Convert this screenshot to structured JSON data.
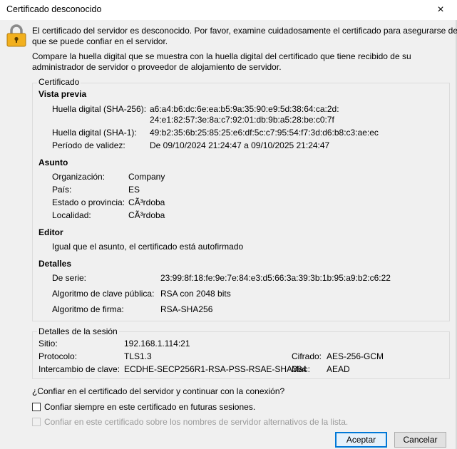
{
  "window": {
    "title": "Certificado desconocido",
    "close_icon": "×"
  },
  "intro": {
    "line1": "El certificado del servidor es desconocido. Por favor, examine cuidadosamente el certificado para asegurarse de",
    "line2": "que se puede confiar en el servidor.",
    "line3": "Compare la huella digital que se muestra con la huella digital del certificado que tiene recibido de su",
    "line4": "administrador de servidor o proveedor de alojamiento de servidor."
  },
  "certificate": {
    "group_label": "Certificado",
    "preview_heading": "Vista previa",
    "sha256_label": "Huella digital (SHA-256):",
    "sha256_line1": "a6:a4:b6:dc:6e:ea:b5:9a:35:90:e9:5d:38:64:ca:2d:",
    "sha256_line2": "24:e1:82:57:3e:8a:c7:92:01:db:9b:a5:28:be:c0:7f",
    "sha1_label": "Huella digital (SHA-1):",
    "sha1_value": "49:b2:35:6b:25:85:25:e6:df:5c:c7:95:54:f7:3d:d6:b8:c3:ae:ec",
    "validity_label": "Período de validez:",
    "validity_value": "De 09/10/2024 21:24:47 a 09/10/2025 21:24:47",
    "subject_heading": "Asunto",
    "org_label": "Organización:",
    "org_value": "Company",
    "country_label": "País:",
    "country_value": "ES",
    "state_label": "Estado o provincia:",
    "state_value": "CÃ³rdoba",
    "locality_label": "Localidad:",
    "locality_value": "CÃ³rdoba",
    "issuer_heading": "Editor",
    "issuer_value": "Igual que el asunto, el certificado está autofirmado",
    "details_heading": "Detalles",
    "serial_label": "De serie:",
    "serial_value": "23:99:8f:18:fe:9e:7e:84:e3:d5:66:3a:39:3b:1b:95:a9:b2:c6:22",
    "pubkey_label": "Algoritmo de clave pública:",
    "pubkey_value": "RSA con 2048 bits",
    "sigalg_label": "Algoritmo de firma:",
    "sigalg_value": "RSA-SHA256"
  },
  "session": {
    "group_label": "Detalles de la sesión",
    "site_label": "Sitio:",
    "site_value": "192.168.1.114:21",
    "protocol_label": "Protocolo:",
    "protocol_value": "TLS1.3",
    "cipher_label": "Cifrado:",
    "cipher_value": "AES-256-GCM",
    "kex_label": "Intercambio de clave:",
    "kex_value": "ECDHE-SECP256R1-RSA-PSS-RSAE-SHA384",
    "mac_label": "Mac:",
    "mac_value": "AEAD"
  },
  "question": "¿Confiar en el certificado del servidor y continuar con la conexión?",
  "options": {
    "always_trust": "Confiar siempre en este certificado en futuras sesiones.",
    "alt_names": "Confiar en este certificado sobre los nombres de servidor alternativos de la lista."
  },
  "buttons": {
    "accept": "Aceptar",
    "cancel": "Cancelar"
  },
  "colors": {
    "accent": "#0078d7",
    "lock_body": "#f2b01e"
  }
}
